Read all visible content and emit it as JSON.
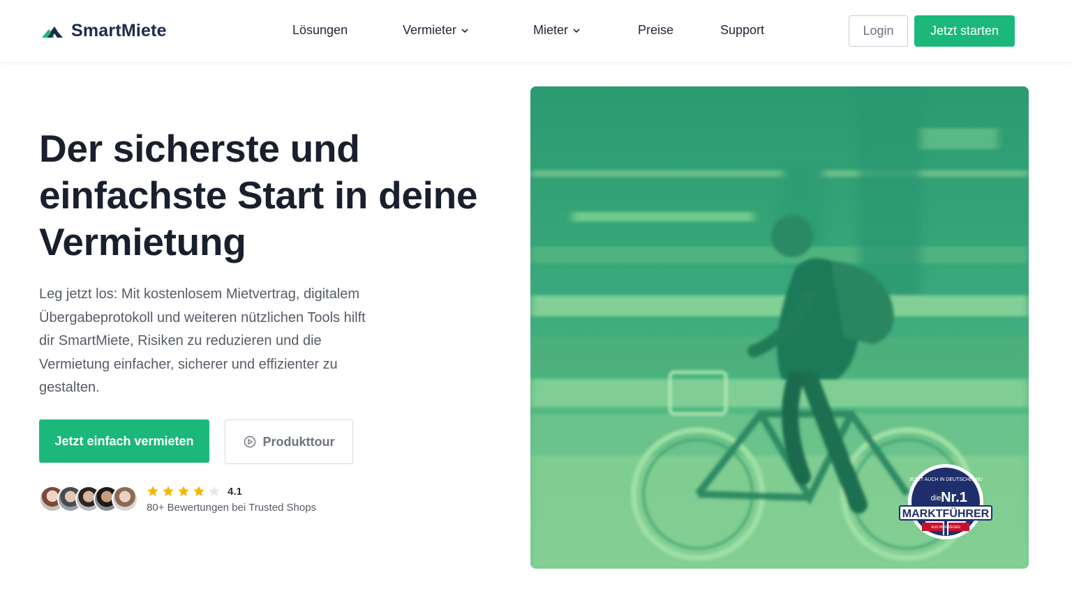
{
  "brand": {
    "name": "SmartMiete",
    "accent": "#1bb87a"
  },
  "nav": {
    "items": [
      {
        "label": "Lösungen",
        "dropdown": false
      },
      {
        "label": "Vermieter",
        "dropdown": true
      },
      {
        "label": "Mieter",
        "dropdown": true
      },
      {
        "label": "Preise",
        "dropdown": false
      },
      {
        "label": "Support",
        "dropdown": false
      }
    ],
    "login_label": "Login",
    "start_label": "Jetzt starten"
  },
  "hero": {
    "title_line1": "Der sicherste und",
    "title_line2": "einfachste Start in deine",
    "title_line3": "Vermietung",
    "description": "Leg jetzt los: Mit kostenlosem Mietvertrag, digitalem Übergabeprotokoll und weiteren nützlichen Tools hilft dir SmartMiete, Risiken zu reduzieren und die Vermietung einfacher, sicherer und effizienter zu gestalten.",
    "primary_cta": "Jetzt einfach vermieten",
    "secondary_cta": "Produkttour"
  },
  "rating": {
    "value": "4.1",
    "stars_filled": 4,
    "stars_total": 5,
    "text": "80+ Bewertungen bei Trusted Shops",
    "avatar_count": 5
  },
  "badge": {
    "arc_text": "JETZT AUCH IN DEUTSCHLAND",
    "prefix": "die",
    "rank": "Nr.1",
    "title": "MARKTFÜHRER",
    "sub": "AUS NORWEGEN"
  },
  "icons": {
    "logo": "smartmiete-logo-icon",
    "chevron": "chevron-down-icon",
    "play": "play-circle-icon",
    "star": "star-icon"
  }
}
